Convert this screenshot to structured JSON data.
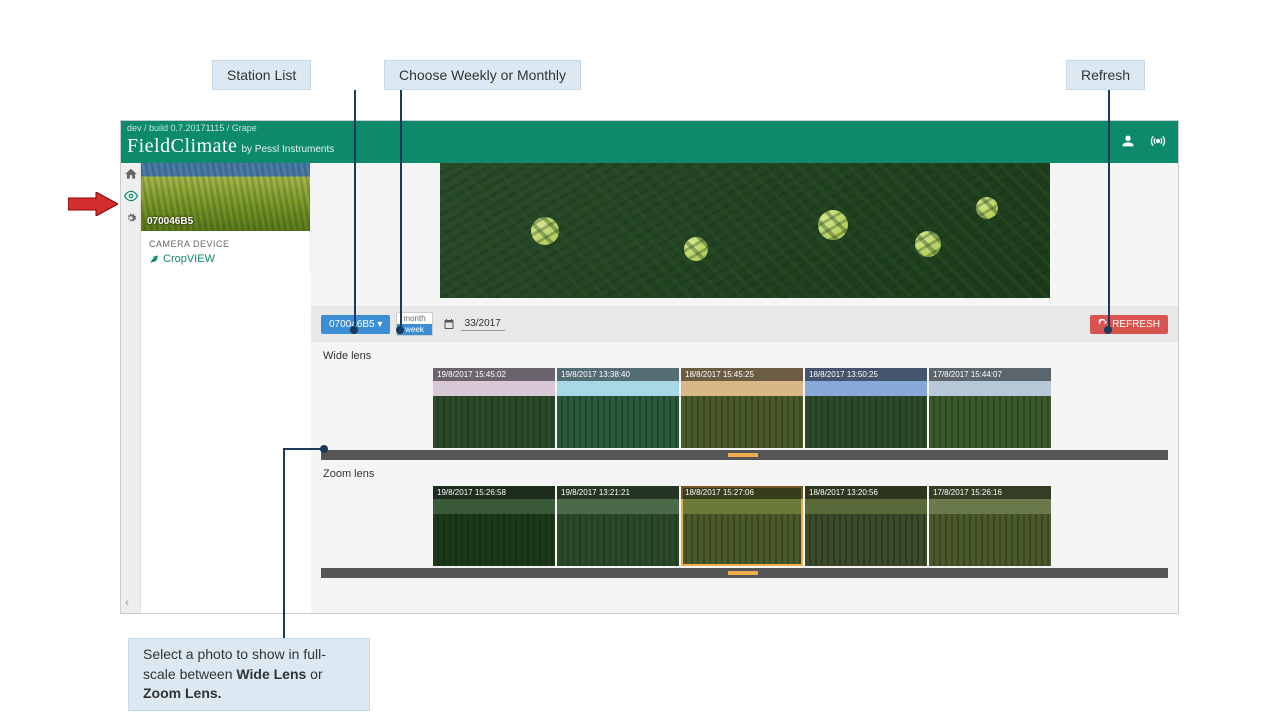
{
  "callouts": {
    "station_list": "Station List",
    "choose_period": "Choose Weekly or Monthly",
    "refresh": "Refresh",
    "select_photo_pre": "Select a photo to show in full-scale between ",
    "select_photo_b1": "Wide Lens",
    "select_photo_mid": " or ",
    "select_photo_b2": "Zoom Lens."
  },
  "header": {
    "breadcrumb": "dev / build 0.7.20171115 / Grape",
    "logo_main": "FieldClimate",
    "logo_sub": "by Pessl Instruments"
  },
  "station": {
    "id": "070046B5",
    "meta_title": "CAMERA DEVICE",
    "link": "CropVIEW"
  },
  "toolbar": {
    "station_btn": "070046B5 ▾",
    "toggle_month": "month",
    "toggle_week": "week",
    "date": "33/2017",
    "refresh": "REFRESH"
  },
  "lenses": {
    "wide": {
      "title": "Wide lens",
      "thumbs": [
        {
          "ts": "19/8/2017 15:45:02",
          "sky": "#d8c8d8",
          "trees": "#2a4a2a"
        },
        {
          "ts": "19/8/2017 13:38:40",
          "sky": "#a8d8e8",
          "trees": "#2a5a3a"
        },
        {
          "ts": "18/8/2017 15:45:25",
          "sky": "#d8b888",
          "trees": "#4a5a2a"
        },
        {
          "ts": "18/8/2017 13:50:25",
          "sky": "#88a8d8",
          "trees": "#2a4a2a"
        },
        {
          "ts": "17/8/2017 15:44:07",
          "sky": "#b8c8d8",
          "trees": "#3a5a2a"
        }
      ]
    },
    "zoom": {
      "title": "Zoom lens",
      "thumbs": [
        {
          "ts": "19/8/2017 15:26:58",
          "sky": "#3a5a3a",
          "trees": "#1a3a1a"
        },
        {
          "ts": "19/8/2017 13:21:21",
          "sky": "#4a6a4a",
          "trees": "#2a4a2a"
        },
        {
          "ts": "18/8/2017 15:27:06",
          "sky": "#6a7a3a",
          "trees": "#4a5a2a",
          "selected": true
        },
        {
          "ts": "18/8/2017 13:20:56",
          "sky": "#5a6a3a",
          "trees": "#3a4a2a"
        },
        {
          "ts": "17/8/2017 15:26:16",
          "sky": "#6a7a4a",
          "trees": "#4a5a2a"
        }
      ]
    }
  }
}
